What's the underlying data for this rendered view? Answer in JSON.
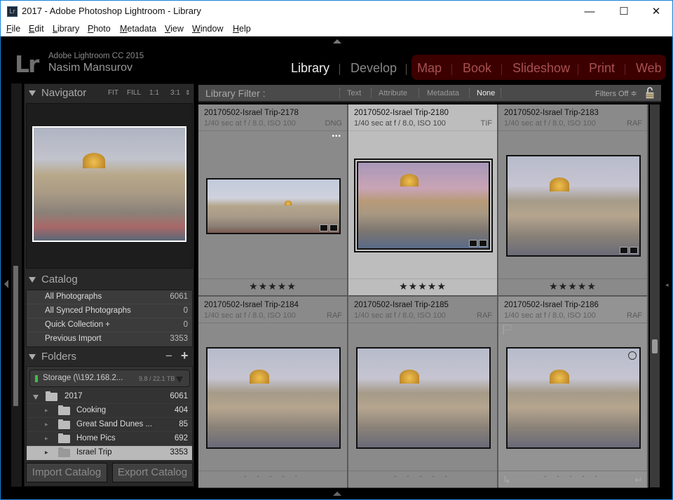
{
  "window": {
    "title": "2017 - Adobe Photoshop Lightroom - Library",
    "app_icon": "Lr",
    "controls": {
      "minimize": "—",
      "maximize": "☐",
      "close": "✕"
    }
  },
  "menubar": [
    {
      "label": "File",
      "accel": "F",
      "rest": "ile"
    },
    {
      "label": "Edit",
      "accel": "E",
      "rest": "dit"
    },
    {
      "label": "Library",
      "accel": "L",
      "rest": "ibrary"
    },
    {
      "label": "Photo",
      "accel": "P",
      "rest": "hoto"
    },
    {
      "label": "Metadata",
      "accel": "M",
      "rest": "etadata"
    },
    {
      "label": "View",
      "accel": "V",
      "rest": "iew"
    },
    {
      "label": "Window",
      "accel": "W",
      "rest": "indow"
    },
    {
      "label": "Help",
      "accel": "H",
      "rest": "elp"
    }
  ],
  "identity": {
    "logo": "Lr",
    "app_name": "Adobe Lightroom CC 2015",
    "user_name": "Nasim Mansurov"
  },
  "modules": [
    {
      "label": "Library",
      "active": true
    },
    {
      "label": "Develop",
      "active": false
    },
    {
      "label": "Map",
      "active": false
    },
    {
      "label": "Book",
      "active": false
    },
    {
      "label": "Slideshow",
      "active": false
    },
    {
      "label": "Print",
      "active": false
    },
    {
      "label": "Web",
      "active": false
    }
  ],
  "navigator": {
    "title": "Navigator",
    "options": [
      "FIT",
      "FILL",
      "1:1",
      "3:1"
    ]
  },
  "catalog": {
    "title": "Catalog",
    "items": [
      {
        "label": "All Photographs",
        "count": "6061"
      },
      {
        "label": "All Synced Photographs",
        "count": "0"
      },
      {
        "label": "Quick Collection  +",
        "count": "0"
      },
      {
        "label": "Previous Import",
        "count": "3353"
      }
    ]
  },
  "folders": {
    "title": "Folders",
    "minus": "−",
    "plus": "+",
    "volume": {
      "name": "Storage  (\\\\192.168.2...",
      "size": "9.8 / 22.1 TB",
      "status_color": "#3cc040"
    },
    "items": [
      {
        "label": "2017",
        "count": "6061",
        "level": 0,
        "expanded": true,
        "selected": false
      },
      {
        "label": "Cooking",
        "count": "404",
        "level": 1,
        "expanded": false,
        "selected": false
      },
      {
        "label": "Great Sand Dunes ...",
        "count": "85",
        "level": 1,
        "expanded": false,
        "selected": false
      },
      {
        "label": "Home Pics",
        "count": "692",
        "level": 1,
        "expanded": false,
        "selected": false
      },
      {
        "label": "Israel Trip",
        "count": "3353",
        "level": 1,
        "expanded": false,
        "selected": true
      }
    ]
  },
  "buttons": {
    "import_catalog": "Import Catalog",
    "export_catalog": "Export Catalog"
  },
  "filter_bar": {
    "title": "Library Filter :",
    "options": [
      {
        "label": "Text",
        "active": false
      },
      {
        "label": "Attribute",
        "active": false
      },
      {
        "label": "Metadata",
        "active": false
      },
      {
        "label": "None",
        "active": true
      }
    ],
    "preset": "Filters Off ≑"
  },
  "grid": {
    "cells": [
      {
        "name": "20170502-Israel Trip-2178",
        "meta": "1/40 sec at f / 8.0, ISO 100",
        "ext": "DNG",
        "rating": "★★★★★",
        "selected": false,
        "pano": true
      },
      {
        "name": "20170502-Israel Trip-2180",
        "meta": "1/40 sec at f / 8.0, ISO 100",
        "ext": "TIF",
        "rating": "★★★★★",
        "selected": true,
        "pano": false
      },
      {
        "name": "20170502-Israel Trip-2183",
        "meta": "1/40 sec at f / 8.0, ISO 100",
        "ext": "RAF",
        "rating": "★★★★★",
        "selected": false,
        "pano": false
      },
      {
        "name": "20170502-Israel Trip-2184",
        "meta": "1/40 sec at f / 8.0, ISO 100",
        "ext": "RAF",
        "rating": "· · · · ·",
        "selected": false,
        "pano": false
      },
      {
        "name": "20170502-Israel Trip-2185",
        "meta": "1/40 sec at f / 8.0, ISO 100",
        "ext": "RAF",
        "rating": "· · · · ·",
        "selected": false,
        "pano": false
      },
      {
        "name": "20170502-Israel Trip-2186",
        "meta": "1/40 sec at f / 8.0, ISO 100",
        "ext": "RAF",
        "rating": "· · · · ·",
        "selected": false,
        "pano": false
      }
    ],
    "more_dots": "•••",
    "rotate_left": "↳",
    "rotate_right": "↵"
  },
  "colors": {
    "accent_selected_cell": "#bdbdbd",
    "module_red_group": "#3c0000",
    "window_border": "#1883d7"
  }
}
